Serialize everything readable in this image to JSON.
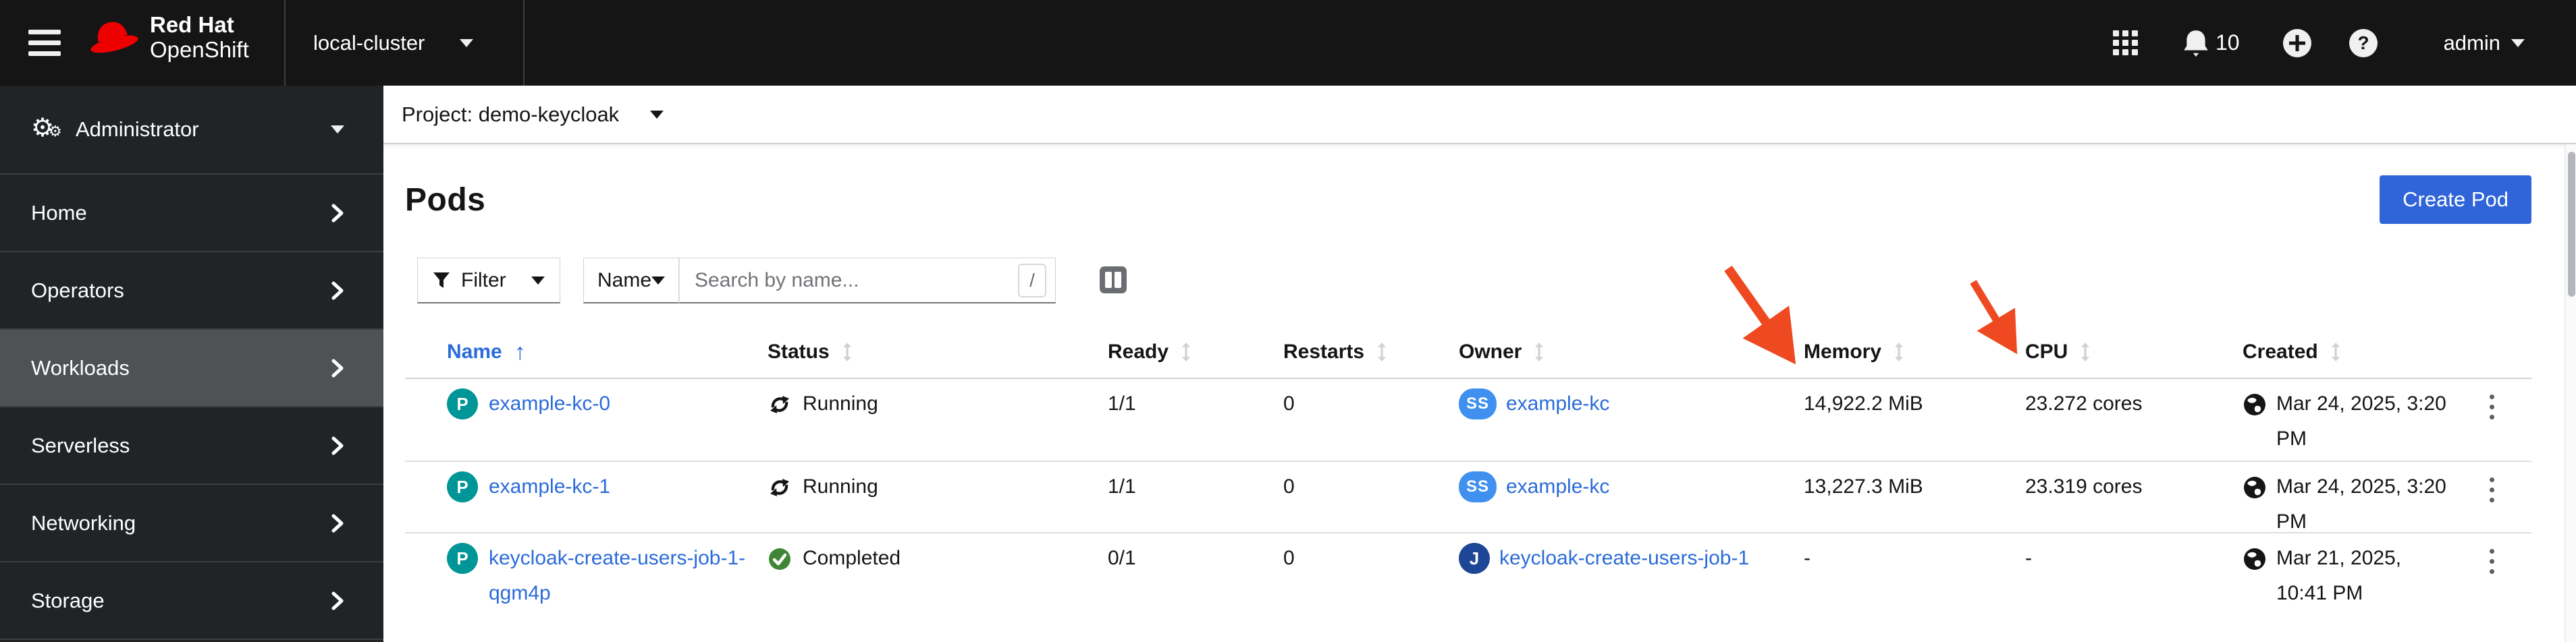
{
  "masthead": {
    "brand_line1": "Red Hat",
    "brand_line2": "OpenShift",
    "cluster": "local-cluster",
    "notification_count": "10",
    "user": "admin"
  },
  "sidebar": {
    "perspective": "Administrator",
    "items": [
      {
        "label": "Home",
        "selected": false
      },
      {
        "label": "Operators",
        "selected": false
      },
      {
        "label": "Workloads",
        "selected": true
      },
      {
        "label": "Serverless",
        "selected": false
      },
      {
        "label": "Networking",
        "selected": false
      },
      {
        "label": "Storage",
        "selected": false
      }
    ]
  },
  "page": {
    "project_label": "Project: demo-keycloak",
    "title": "Pods",
    "create_button": "Create Pod"
  },
  "toolbar": {
    "filter_label": "Filter",
    "search_attribute": "Name",
    "search_placeholder": "Search by name...",
    "search_shortcut": "/"
  },
  "table": {
    "columns": [
      {
        "label": "Name",
        "sorted": "asc"
      },
      {
        "label": "Status",
        "sortable": true
      },
      {
        "label": "Ready",
        "sortable": true
      },
      {
        "label": "Restarts",
        "sortable": true
      },
      {
        "label": "Owner",
        "sortable": true
      },
      {
        "label": "Memory",
        "sortable": true
      },
      {
        "label": "CPU",
        "sortable": true
      },
      {
        "label": "Created",
        "sortable": true
      }
    ],
    "rows": [
      {
        "name": {
          "badge": "P",
          "text": "example-kc-0"
        },
        "status": {
          "icon": "running-sync-icon",
          "text": "Running"
        },
        "ready": "1/1",
        "restarts": "0",
        "owner": {
          "badge": "SS",
          "text": "example-kc"
        },
        "memory": "14,922.2 MiB",
        "cpu": "23.272 cores",
        "created": "Mar 24, 2025, 3:20 PM"
      },
      {
        "name": {
          "badge": "P",
          "text": "example-kc-1"
        },
        "status": {
          "icon": "running-sync-icon",
          "text": "Running"
        },
        "ready": "1/1",
        "restarts": "0",
        "owner": {
          "badge": "SS",
          "text": "example-kc"
        },
        "memory": "13,227.3 MiB",
        "cpu": "23.319 cores",
        "created": "Mar 24, 2025, 3:20 PM"
      },
      {
        "name": {
          "badge": "P",
          "text": "keycloak-create-users-job-1-qgm4p"
        },
        "status": {
          "icon": "check-circle-icon",
          "text": "Completed"
        },
        "ready": "0/1",
        "restarts": "0",
        "owner": {
          "badge": "J",
          "text": "keycloak-create-users-job-1"
        },
        "memory": "-",
        "cpu": "-",
        "created": "Mar 21, 2025, 10:41 PM"
      }
    ]
  },
  "annotations": {
    "arrow_color": "#ee4921",
    "arrows": [
      {
        "points_to": "Memory column"
      },
      {
        "points_to": "CPU column"
      }
    ]
  },
  "colors": {
    "masthead_bg": "#151515",
    "sidebar_bg": "#212427",
    "sidebar_selected": "#4f5255",
    "accent_blue": "#2f65d9",
    "link_blue": "#2b6bd9",
    "pod_badge": "#009596",
    "statefulset_badge": "#4090f0",
    "job_badge": "#1d4696",
    "success_green": "#3e8635"
  }
}
